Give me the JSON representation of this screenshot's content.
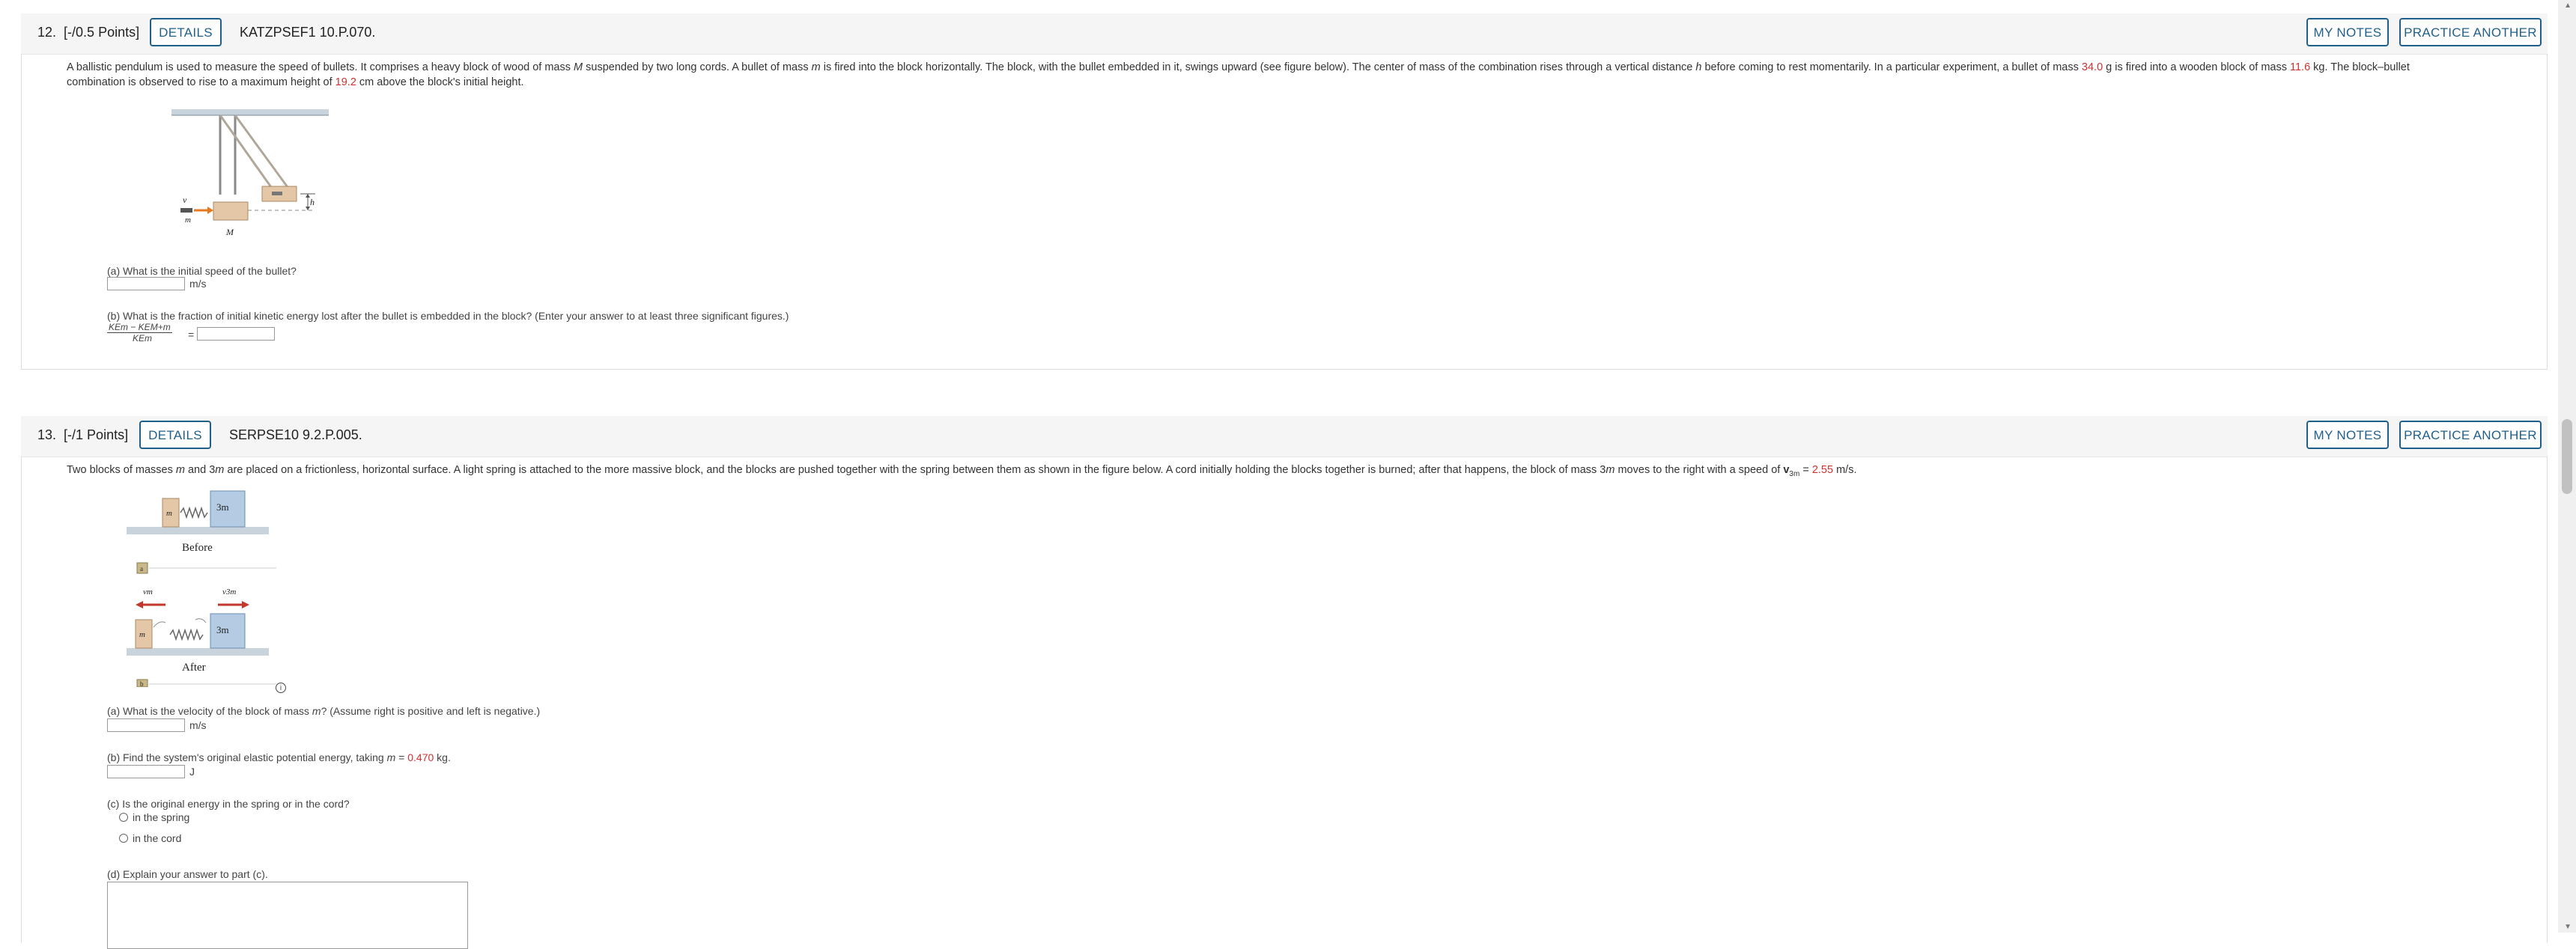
{
  "q12": {
    "number": "12.",
    "points": "[-/0.5 Points]",
    "details_label": "DETAILS",
    "code": "KATZPSEF1 10.P.070.",
    "my_notes_label": "MY NOTES",
    "practice_label": "PRACTICE ANOTHER",
    "text_1": "A ballistic pendulum is used to measure the speed of bullets. It comprises a heavy block of wood of mass ",
    "sym_M": "M",
    "text_2": " suspended by two long cords. A bullet of mass ",
    "sym_m": "m",
    "text_3": " is fired into the block horizontally. The block, with the bullet embedded in it, swings upward (see figure below). The center of mass of the combination rises through a vertical distance ",
    "sym_h": "h",
    "text_4": " before coming to rest momentarily. In a particular experiment, a bullet of mass ",
    "bullet_mass": "34.0",
    "text_5": " g is fired into a wooden block of mass ",
    "block_mass": "11.6",
    "text_6": " kg. The block–bullet",
    "text_7": "combination is observed to rise to a maximum height of ",
    "height": "19.2",
    "text_8": " cm above the block's initial height.",
    "fig_v": "v",
    "fig_m": "m",
    "fig_M": "M",
    "fig_h": "h",
    "part_a": "(a) What is the initial speed of the bullet?",
    "part_a_unit": "m/s",
    "part_b": "(b) What is the fraction of initial kinetic energy lost after the bullet is embedded in the block? (Enter your answer to at least three significant figures.)",
    "fraction_num": "KEm − KEM+m",
    "fraction_den": "KEm",
    "fraction_eq": "="
  },
  "q13": {
    "number": "13.",
    "points": "[-/1 Points]",
    "details_label": "DETAILS",
    "code": "SERPSE10 9.2.P.005.",
    "my_notes_label": "MY NOTES",
    "practice_label": "PRACTICE ANOTHER",
    "text_1": "Two blocks of masses ",
    "text_2": " and 3",
    "text_3": " are placed on a frictionless, horizontal surface. A light spring is attached to the more massive block, and the blocks are pushed together with the spring between them as shown in the figure below. A cord initially holding the blocks together is burned; after that happens, the block of mass 3",
    "text_4": " moves to the right with a speed of ",
    "v_sym": "v",
    "v_sub": "3m",
    "v_eq": " = ",
    "speed": "2.55",
    "speed_unit": " m/s.",
    "sym_m": "m",
    "fig_before": "Before",
    "fig_after": "After",
    "fig_a": "a",
    "fig_b": "b",
    "fig_m": "m",
    "fig_3m": "3m",
    "fig_vm": "vm",
    "fig_v3m": "v3m",
    "info_icon": "i",
    "part_a_1": "(a) What is the velocity of the block of mass ",
    "part_a_2": "? (Assume right is positive and left is negative.)",
    "part_a_unit": "m/s",
    "part_b_1": "(b) Find the system's original elastic potential energy, taking ",
    "part_b_2": " = ",
    "mass_value": "0.470",
    "part_b_3": " kg.",
    "part_b_unit": "J",
    "part_c": "(c) Is the original energy in the spring or in the cord?",
    "option_1": "in the spring",
    "option_2": "in the cord",
    "part_d": "(d) Explain your answer to part (c)."
  },
  "colors": {
    "accent": "#1f5f8b",
    "red_values": "#d0312d"
  }
}
